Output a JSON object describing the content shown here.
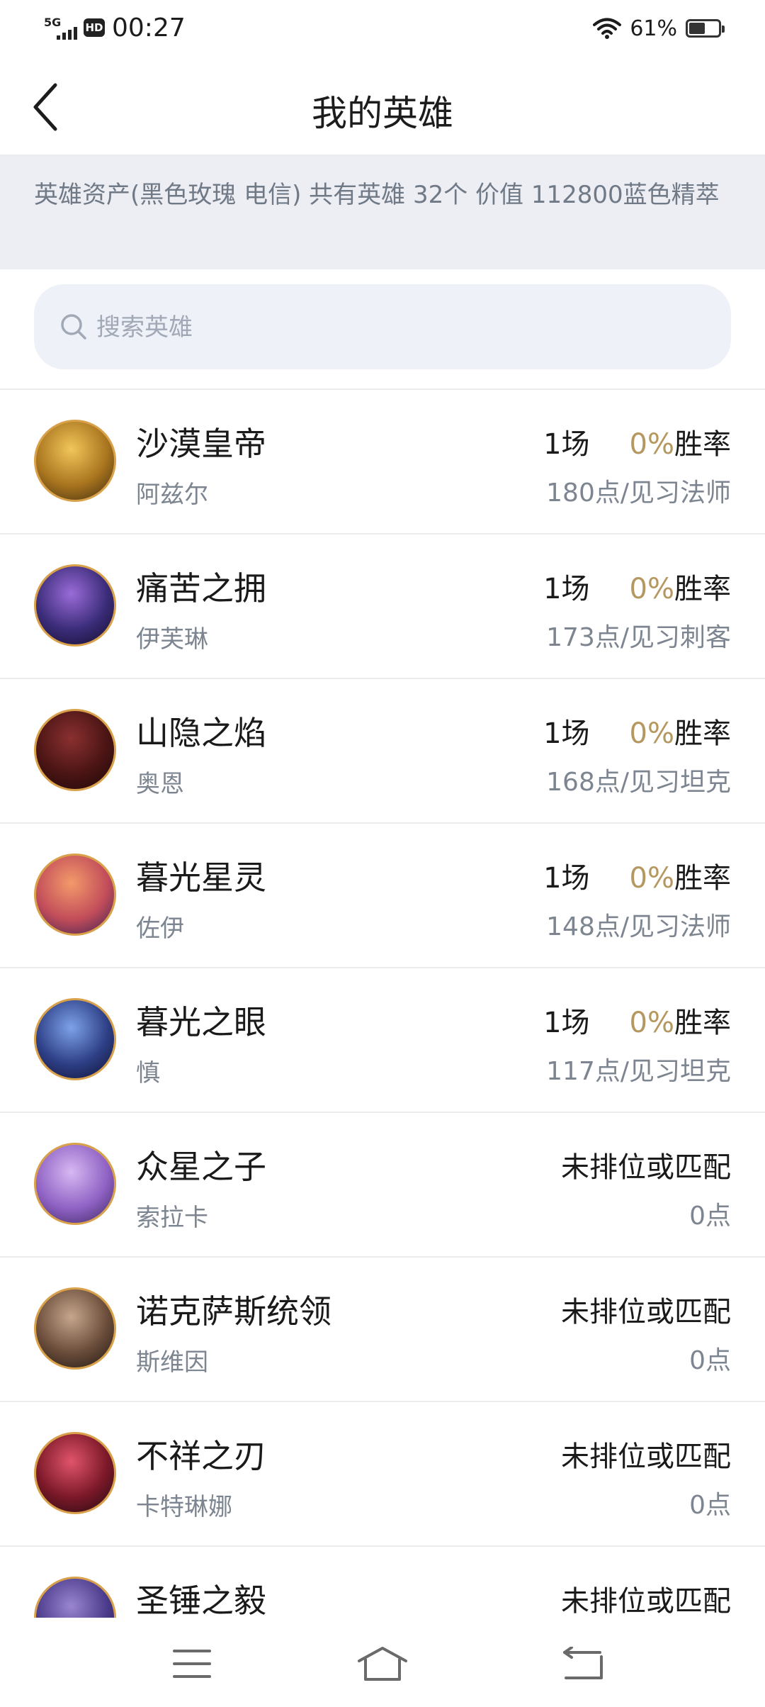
{
  "status": {
    "network": "5G",
    "hd": "HD",
    "time": "00:27",
    "battery_text": "61%",
    "battery_level": 0.61
  },
  "nav": {
    "title": "我的英雄"
  },
  "banner": {
    "text": "英雄资产(黑色玫瑰 电信)  共有英雄 32个  价值 112800蓝色精萃"
  },
  "search": {
    "placeholder": "搜索英雄",
    "value": ""
  },
  "heroes": [
    {
      "name": "沙漠皇帝",
      "sub": "阿兹尔",
      "games": "1场",
      "rate_value": "0%",
      "rate_label": "胜率",
      "points": "180点/见习法师",
      "status": "",
      "avatar_colors": [
        "#f2c65a",
        "#a8741e",
        "#3b2a10"
      ]
    },
    {
      "name": "痛苦之拥",
      "sub": "伊芙琳",
      "games": "1场",
      "rate_value": "0%",
      "rate_label": "胜率",
      "points": "173点/见习刺客",
      "status": "",
      "avatar_colors": [
        "#9a6bd8",
        "#3a2c78",
        "#120c2a"
      ]
    },
    {
      "name": "山隐之焰",
      "sub": "奥恩",
      "games": "1场",
      "rate_value": "0%",
      "rate_label": "胜率",
      "points": "168点/见习坦克",
      "status": "",
      "avatar_colors": [
        "#8a3030",
        "#4a1414",
        "#1c0808"
      ]
    },
    {
      "name": "暮光星灵",
      "sub": "佐伊",
      "games": "1场",
      "rate_value": "0%",
      "rate_label": "胜率",
      "points": "148点/见习法师",
      "status": "",
      "avatar_colors": [
        "#f39a6a",
        "#c24d5a",
        "#3b2052"
      ]
    },
    {
      "name": "暮光之眼",
      "sub": "慎",
      "games": "1场",
      "rate_value": "0%",
      "rate_label": "胜率",
      "points": "117点/见习坦克",
      "status": "",
      "avatar_colors": [
        "#7da2e8",
        "#2e3f86",
        "#0c1030"
      ]
    },
    {
      "name": "众星之子",
      "sub": "索拉卡",
      "games": "",
      "rate_value": "",
      "rate_label": "",
      "points": "0点",
      "status": "未排位或匹配",
      "avatar_colors": [
        "#d7b8f2",
        "#8f62c4",
        "#3a2560"
      ]
    },
    {
      "name": "诺克萨斯统领",
      "sub": "斯维因",
      "games": "",
      "rate_value": "",
      "rate_label": "",
      "points": "0点",
      "status": "未排位或匹配",
      "avatar_colors": [
        "#c6a68c",
        "#6a4c3a",
        "#1c1612"
      ]
    },
    {
      "name": "不祥之刃",
      "sub": "卡特琳娜",
      "games": "",
      "rate_value": "",
      "rate_label": "",
      "points": "0点",
      "status": "未排位或匹配",
      "avatar_colors": [
        "#e0546a",
        "#7a1828",
        "#1e0c10"
      ]
    },
    {
      "name": "圣锤之毅",
      "sub": "",
      "games": "",
      "rate_value": "",
      "rate_label": "",
      "points": "",
      "status": "未排位或匹配",
      "avatar_colors": [
        "#9a86d0",
        "#4a3a8a",
        "#1a1438"
      ]
    }
  ],
  "bottom_nav": {
    "menu_icon": "menu-icon",
    "home_icon": "home-icon",
    "back_icon": "return-icon"
  }
}
